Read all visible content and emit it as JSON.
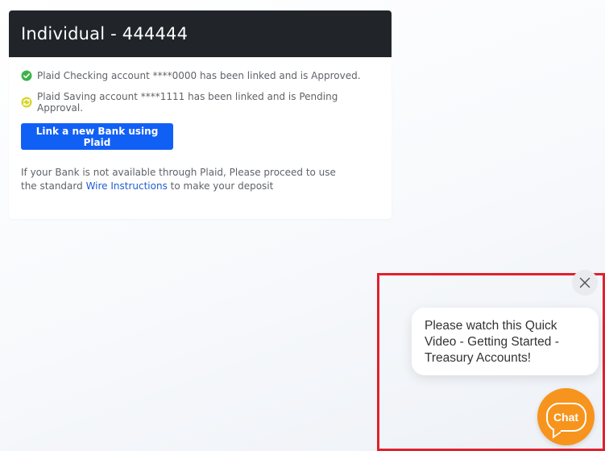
{
  "card": {
    "title": "Individual - 444444",
    "accounts": [
      {
        "text": "Plaid Checking account ****0000 has been linked and is Approved.",
        "status": "approved",
        "icon": "check-circle-icon",
        "color": "#3cb44b"
      },
      {
        "text": "Plaid Saving account ****1111 has been linked and is Pending Approval.",
        "status": "pending",
        "icon": "pending-circle-icon",
        "color": "#c8c81e"
      }
    ],
    "link_button_label": "Link a new Bank using Plaid",
    "note_line1": "If your Bank is not available through Plaid, Please proceed to use",
    "note_prefix": "the standard ",
    "note_link": "Wire Instructions",
    "note_suffix": " to make your deposit"
  },
  "chat_widget": {
    "message": "Please watch this Quick Video - Getting Started - Treasury Accounts!",
    "button_label": "Chat",
    "close_icon": "close-icon",
    "accent_color": "#f7941d"
  },
  "colors": {
    "header_bg": "#212429",
    "primary_button": "#1160f6",
    "link": "#1f5fd1",
    "highlight_border": "#e0202d"
  }
}
